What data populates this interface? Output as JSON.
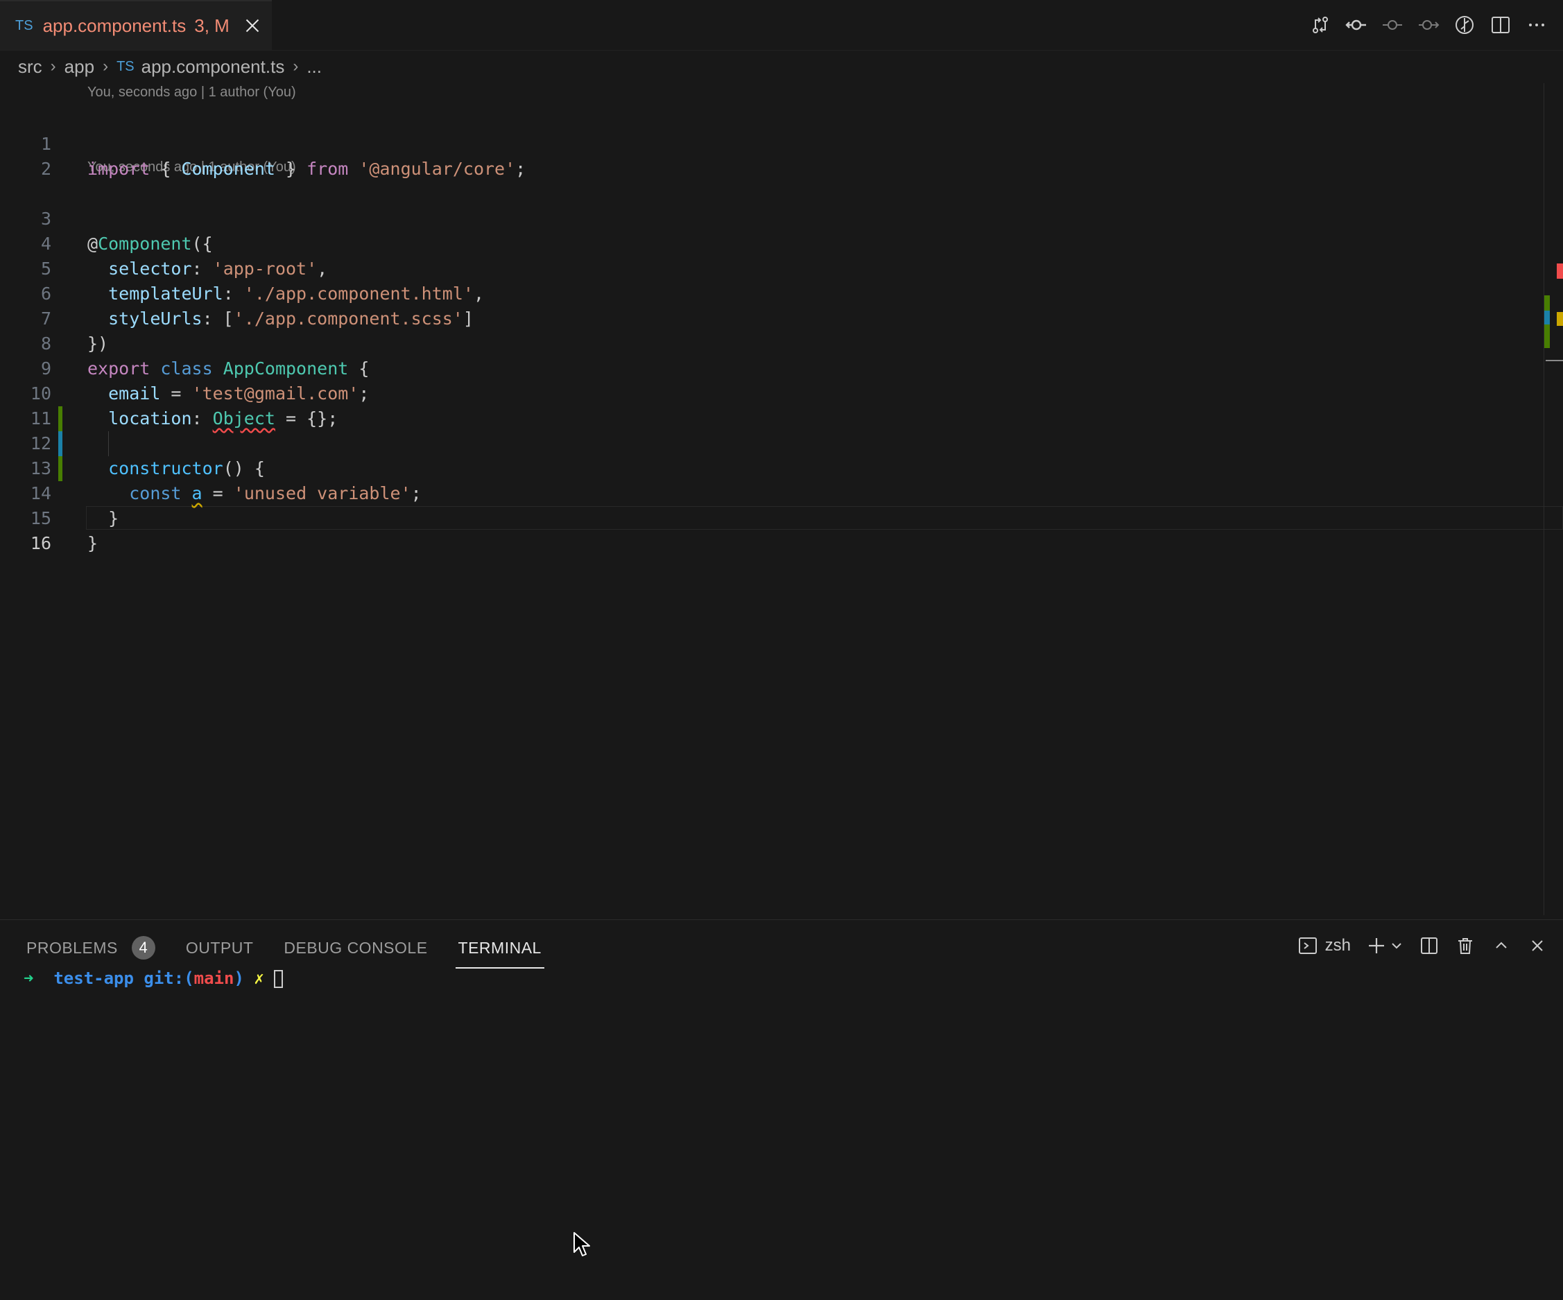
{
  "tab": {
    "lang": "TS",
    "filename": "app.component.ts",
    "badge": "3, M"
  },
  "toolbar_icons": [
    "compare-changes-icon",
    "git-commit-icon",
    "previous-change-icon",
    "next-change-icon",
    "timeline-icon",
    "split-editor-icon",
    "more-actions-icon"
  ],
  "breadcrumb": {
    "items": [
      "src",
      "app"
    ],
    "file_lang": "TS",
    "file": "app.component.ts",
    "more": "..."
  },
  "editor": {
    "lens1": "You, seconds ago | 1 author (You)",
    "lens2": "You, seconds ago | 1 author (You)",
    "line_numbers": [
      "1",
      "2",
      "3",
      "4",
      "5",
      "6",
      "7",
      "8",
      "9",
      "10",
      "11",
      "12",
      "13",
      "14",
      "15",
      "16"
    ],
    "l1": {
      "import": "import",
      "b1": " { ",
      "component": "Component",
      "b2": " } ",
      "from": "from",
      "sp": " ",
      "str": "'@angular/core'",
      "semi": ";"
    },
    "l3": {
      "at": "@",
      "dec": "Component",
      "rest": "({"
    },
    "l4": {
      "prop": "selector",
      "colon": ": ",
      "str": "'app-root'",
      "comma": ","
    },
    "l5": {
      "prop": "templateUrl",
      "colon": ": ",
      "str": "'./app.component.html'",
      "comma": ","
    },
    "l6": {
      "prop": "styleUrls",
      "colon": ": [",
      "str": "'./app.component.scss'",
      "close": "]"
    },
    "l7": {
      "text": "})"
    },
    "l8": {
      "export": "export",
      "sp1": " ",
      "class": "class",
      "sp2": " ",
      "name": "AppComponent",
      "rest": " {"
    },
    "l9": {
      "prop": "email",
      "eq": " = ",
      "str": "'test@gmail.com'",
      "semi": ";"
    },
    "l10": {
      "prop": "location",
      "colon": ": ",
      "type": "Object",
      "rest": " = {};"
    },
    "l12": {
      "fn": "constructor",
      "rest": "() {"
    },
    "l13": {
      "const": "const",
      "sp": " ",
      "var": "a",
      "eq": " = ",
      "str": "'unused variable'",
      "semi": ";"
    },
    "l14": {
      "text": "}"
    },
    "l15": {
      "text": "}"
    }
  },
  "panel": {
    "tabs": [
      "PROBLEMS",
      "OUTPUT",
      "DEBUG CONSOLE",
      "TERMINAL"
    ],
    "problems_count": "4",
    "active_tab": "TERMINAL",
    "shell": "zsh"
  },
  "terminal": {
    "arrow": "➜",
    "dir": "test-app",
    "git": "git:(",
    "branch": "main",
    "git_close": ")",
    "dirty": "✗"
  },
  "colors": {
    "tab_modified": "#f38c75",
    "gutter_added": "#487e02",
    "gutter_modified": "#1b81a8",
    "error": "#f14c4c",
    "warning": "#cca700"
  }
}
